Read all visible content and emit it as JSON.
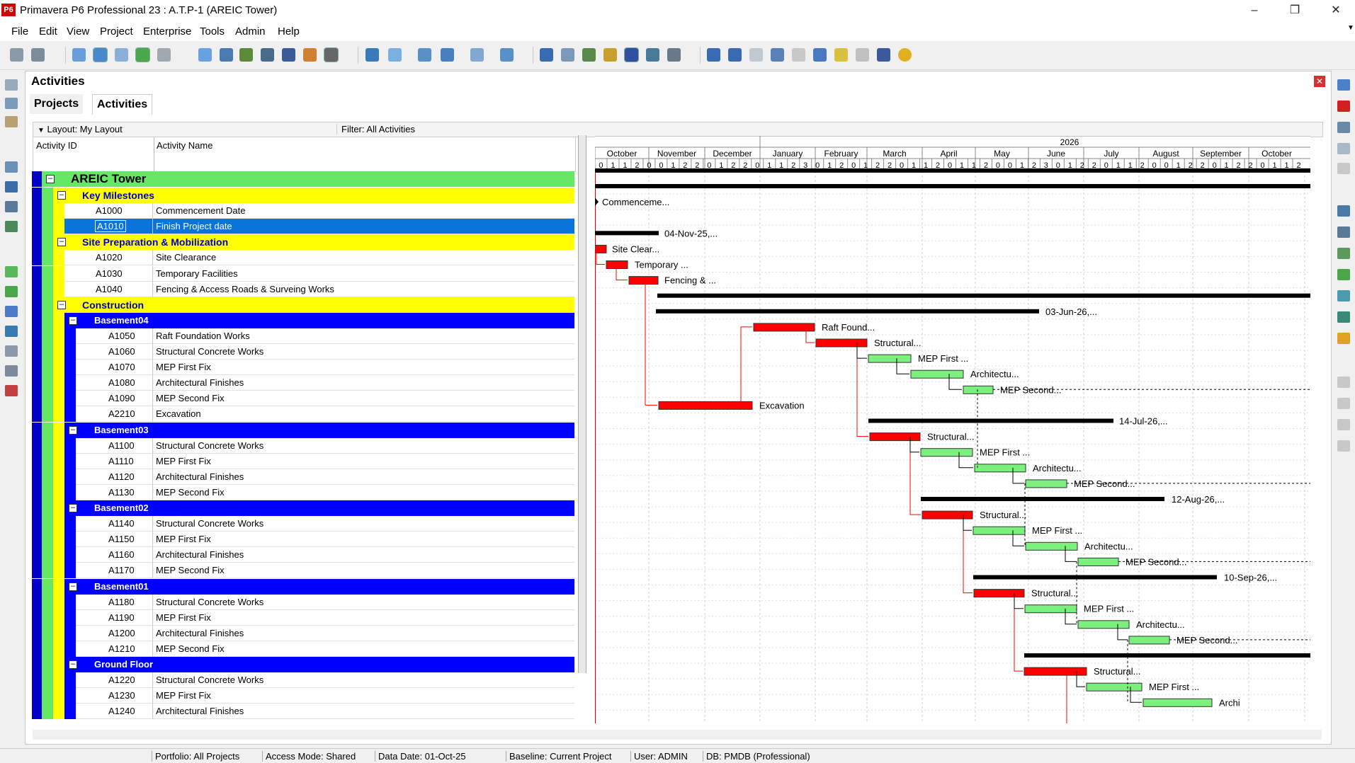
{
  "window": {
    "title": "Primavera P6 Professional 23 : A.T.P-1 (AREIC Tower)",
    "logo": "P6"
  },
  "menu": [
    "File",
    "Edit",
    "View",
    "Project",
    "Enterprise",
    "Tools",
    "Admin",
    "Help"
  ],
  "panel": {
    "title": "Activities",
    "tabs": [
      "Projects",
      "Activities"
    ]
  },
  "layout_label": "Layout: My Layout",
  "filter_label": "Filter: All Activities",
  "columns": {
    "id": "Activity ID",
    "name": "Activity Name"
  },
  "project": {
    "name": "AREIC Tower"
  },
  "rows": [
    {
      "type": "wbs1",
      "name": "Key Milestones"
    },
    {
      "type": "act",
      "id": "A1000",
      "name": "Commencement Date",
      "level": 1
    },
    {
      "type": "act",
      "id": "A1010",
      "name": "Finish Project date",
      "level": 1,
      "selected": true
    },
    {
      "type": "wbs1",
      "name": "Site Preparation & Mobilization"
    },
    {
      "type": "act",
      "id": "A1020",
      "name": "Site Clearance",
      "level": 1
    },
    {
      "type": "act",
      "id": "A1030",
      "name": "Temporary Facilities",
      "level": 1
    },
    {
      "type": "act",
      "id": "A1040",
      "name": "Fencing & Access Roads & Surveing Works",
      "level": 1
    },
    {
      "type": "wbs1",
      "name": "Construction"
    },
    {
      "type": "wbs2",
      "name": "Basement04"
    },
    {
      "type": "act",
      "id": "A1050",
      "name": "Raft Foundation Works",
      "level": 2
    },
    {
      "type": "act",
      "id": "A1060",
      "name": "Structural Concrete Works",
      "level": 2
    },
    {
      "type": "act",
      "id": "A1070",
      "name": "MEP First Fix",
      "level": 2
    },
    {
      "type": "act",
      "id": "A1080",
      "name": "Architectural Finishes",
      "level": 2
    },
    {
      "type": "act",
      "id": "A1090",
      "name": "MEP Second Fix",
      "level": 2
    },
    {
      "type": "act",
      "id": "A2210",
      "name": "Excavation",
      "level": 2
    },
    {
      "type": "wbs2",
      "name": "Basement03"
    },
    {
      "type": "act",
      "id": "A1100",
      "name": "Structural Concrete Works",
      "level": 2
    },
    {
      "type": "act",
      "id": "A1110",
      "name": "MEP First Fix",
      "level": 2
    },
    {
      "type": "act",
      "id": "A1120",
      "name": "Architectural Finishes",
      "level": 2
    },
    {
      "type": "act",
      "id": "A1130",
      "name": "MEP Second Fix",
      "level": 2
    },
    {
      "type": "wbs2",
      "name": "Basement02"
    },
    {
      "type": "act",
      "id": "A1140",
      "name": "Structural Concrete Works",
      "level": 2
    },
    {
      "type": "act",
      "id": "A1150",
      "name": "MEP First Fix",
      "level": 2
    },
    {
      "type": "act",
      "id": "A1160",
      "name": "Architectural Finishes",
      "level": 2
    },
    {
      "type": "act",
      "id": "A1170",
      "name": "MEP Second Fix",
      "level": 2
    },
    {
      "type": "wbs2",
      "name": "Basement01"
    },
    {
      "type": "act",
      "id": "A1180",
      "name": "Structural Concrete Works",
      "level": 2
    },
    {
      "type": "act",
      "id": "A1190",
      "name": "MEP First Fix",
      "level": 2
    },
    {
      "type": "act",
      "id": "A1200",
      "name": "Architectural Finishes",
      "level": 2
    },
    {
      "type": "act",
      "id": "A1210",
      "name": "MEP Second Fix",
      "level": 2
    },
    {
      "type": "wbs2",
      "name": "Ground Floor"
    },
    {
      "type": "act",
      "id": "A1220",
      "name": "Structural Concrete Works",
      "level": 2
    },
    {
      "type": "act",
      "id": "A1230",
      "name": "MEP First Fix",
      "level": 2
    },
    {
      "type": "act",
      "id": "A1240",
      "name": "Architectural Finishes",
      "level": 2
    }
  ],
  "timescale": {
    "year": "2026",
    "months": [
      "October",
      "November",
      "December",
      "January",
      "February",
      "March",
      "April",
      "May",
      "June",
      "July",
      "August",
      "September",
      "October"
    ],
    "weeks": [
      "0",
      "1",
      "1",
      "2",
      "0",
      "0",
      "1",
      "2",
      "2",
      "0",
      "1",
      "2",
      "2",
      "0",
      "1",
      "1",
      "2",
      "3",
      "0",
      "1",
      "2",
      "0",
      "1",
      "2",
      "2",
      "0",
      "1",
      "1",
      "2",
      "0",
      "1",
      "1",
      "2",
      "0",
      "0",
      "1",
      "2",
      "3",
      "0",
      "1",
      "2",
      "2",
      "0",
      "1",
      "1",
      "2",
      "0",
      "0",
      "1",
      "2",
      "2",
      "0",
      "1",
      "2",
      "2",
      "0",
      "1",
      "1",
      "2"
    ]
  },
  "gantt_labels": {
    "commencement": "Commenceme...",
    "site_prep_finish": "04-Nov-25,...",
    "site_clear": "Site Clear...",
    "temporary": "Temporary ...",
    "fencing": "Fencing & ...",
    "b04_finish": "03-Jun-26,...",
    "raft": "Raft Found...",
    "structural": "Structural...",
    "mep_first": "MEP First ...",
    "architectu": "Architectu...",
    "mep_second": "MEP Second...",
    "excavation": "Excavation",
    "b03_finish": "14-Jul-26,...",
    "b02_finish": "12-Aug-26,...",
    "b01_finish": "10-Sep-26,...",
    "archi": "Archi"
  },
  "status": {
    "portfolio": "Portfolio: All Projects",
    "access": "Access Mode: Shared",
    "data_date": "Data Date: 01-Oct-25",
    "baseline": "Baseline: Current Project",
    "user": "User: ADMIN",
    "db": "DB: PMDB (Professional)"
  },
  "colors": {
    "wbs_green": "#66e866",
    "wbs_yellow": "#ffff00",
    "wbs_blue": "#0000ff",
    "critical": "#ff0000",
    "normal": "#7cf07c",
    "summary": "#000000",
    "selected": "#0a74da"
  }
}
